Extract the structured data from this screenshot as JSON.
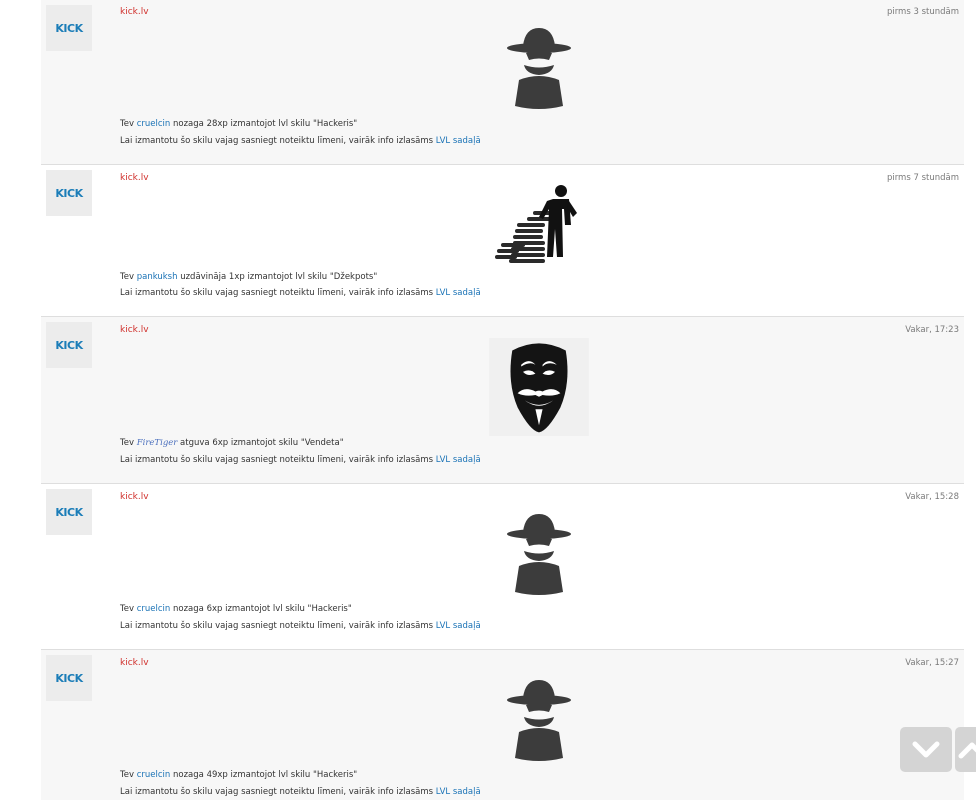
{
  "feed": {
    "items": [
      {
        "site": "kick.lv",
        "time": "pirms 3 stundām",
        "avatar": "KICK",
        "icon": "hacker-icon",
        "pre": "Tev ",
        "user": "cruelcin",
        "post": " nozaga 28xp izmantojot lvl skilu \"Hackeris\"",
        "info": "Lai izmantotu šo skilu vajag sasniegt noteiktu līmeni, vairāk info izlasāms ",
        "info_link": "LVL sadaļā"
      },
      {
        "site": "kick.lv",
        "time": "pirms 7 stundām",
        "avatar": "KICK",
        "icon": "jackpot-icon",
        "pre": "Tev ",
        "user": "pankuksh",
        "post": " uzdāvināja 1xp izmantojot lvl skilu \"Džekpots\"",
        "info": "Lai izmantotu šo skilu vajag sasniegt noteiktu līmeni, vairāk info izlasāms ",
        "info_link": "LVL sadaļā"
      },
      {
        "site": "kick.lv",
        "time": "Vakar, 17:23",
        "avatar": "KICK",
        "icon": "vendetta-mask-icon",
        "pre": "Tev ",
        "user": "FireTiger",
        "post": " atguva 6xp izmantojot skilu \"Vendeta\"",
        "info": "Lai izmantotu šo skilu vajag sasniegt noteiktu līmeni, vairāk info izlasāms ",
        "info_link": "LVL sadaļā"
      },
      {
        "site": "kick.lv",
        "time": "Vakar, 15:28",
        "avatar": "KICK",
        "icon": "hacker-icon",
        "pre": "Tev ",
        "user": "cruelcin",
        "post": " nozaga 6xp izmantojot lvl skilu \"Hackeris\"",
        "info": "Lai izmantotu šo skilu vajag sasniegt noteiktu līmeni, vairāk info izlasāms ",
        "info_link": "LVL sadaļā"
      },
      {
        "site": "kick.lv",
        "time": "Vakar, 15:27",
        "avatar": "KICK",
        "icon": "hacker-icon",
        "pre": "Tev ",
        "user": "cruelcin",
        "post": " nozaga 49xp izmantojot lvl skilu \"Hackeris\"",
        "info": "Lai izmantotu šo skilu vajag sasniegt noteiktu līmeni, vairāk info izlasāms ",
        "info_link": "LVL sadaļā"
      }
    ]
  },
  "colors": {
    "site": "#d0312d",
    "link": "#1b73b6",
    "avatar": "#1b7db8",
    "icon": "#3c3c3c"
  },
  "scroll_buttons": {
    "down_icon": "chevron-down-icon",
    "up_icon": "chevron-up-icon"
  }
}
